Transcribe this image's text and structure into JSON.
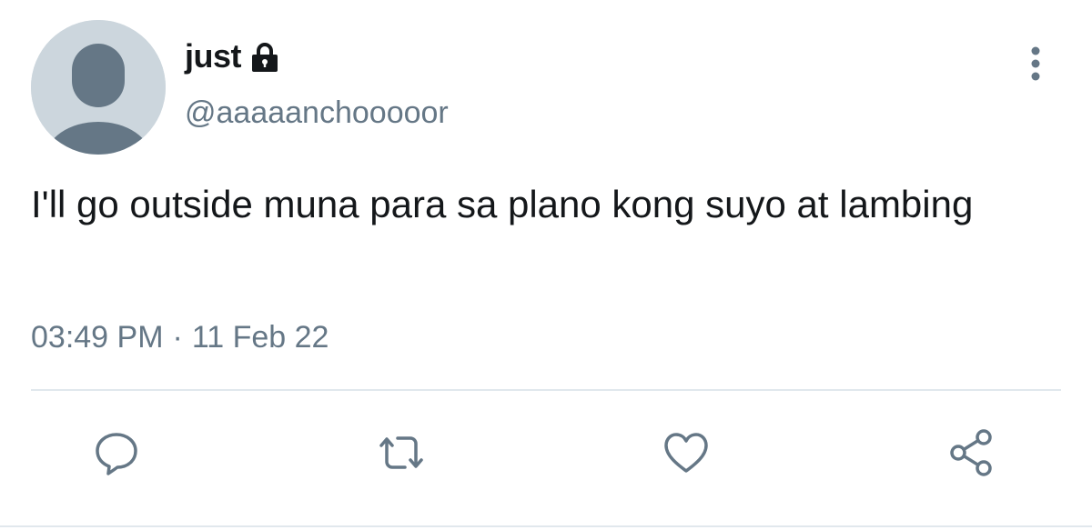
{
  "user": {
    "display_name": "just",
    "handle": "@aaaaanchooooor",
    "protected_icon": "lock-icon",
    "avatar_icon": "default-avatar-icon"
  },
  "tweet": {
    "text": "I'll go outside muna para sa plano kong suyo at lambing",
    "time": "03:49 PM",
    "separator": "·",
    "date": "11 Feb 22"
  },
  "actions": [
    {
      "name": "reply",
      "icon": "comment-icon"
    },
    {
      "name": "retweet",
      "icon": "retweet-icon"
    },
    {
      "name": "like",
      "icon": "heart-icon"
    },
    {
      "name": "share",
      "icon": "share-icon"
    }
  ],
  "menu": {
    "icon": "more-vertical-icon"
  },
  "colors": {
    "text_primary": "#14171a",
    "text_secondary": "#657786",
    "avatar_bg": "#ccd6dd",
    "avatar_fg": "#657786",
    "divider": "#e1e8ed"
  }
}
